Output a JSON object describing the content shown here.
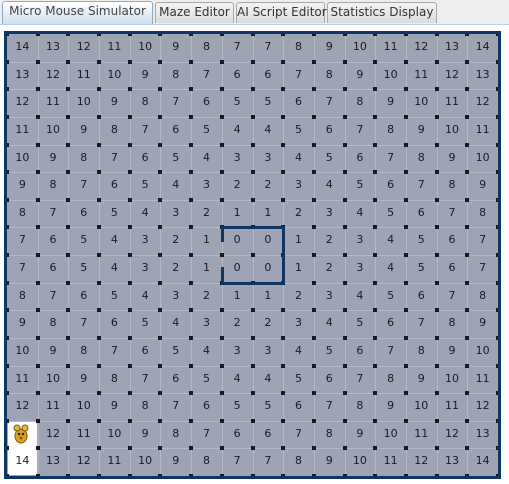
{
  "tabs": [
    {
      "label": "Micro Mouse Simulator",
      "active": true
    },
    {
      "label": "Maze Editor",
      "active": false
    },
    {
      "label": "AI Script Editor",
      "active": false
    },
    {
      "label": "Statistics Display",
      "active": false
    }
  ],
  "maze": {
    "rows": [
      [
        "14",
        "13",
        "12",
        "11",
        "10",
        "9",
        "8",
        "7",
        "7",
        "8",
        "9",
        "10",
        "11",
        "12",
        "13",
        "14"
      ],
      [
        "13",
        "12",
        "11",
        "10",
        "9",
        "8",
        "7",
        "6",
        "6",
        "7",
        "8",
        "9",
        "10",
        "11",
        "12",
        "13"
      ],
      [
        "12",
        "11",
        "10",
        "9",
        "8",
        "7",
        "6",
        "5",
        "5",
        "6",
        "7",
        "8",
        "9",
        "10",
        "11",
        "12"
      ],
      [
        "11",
        "10",
        "9",
        "8",
        "7",
        "6",
        "5",
        "4",
        "4",
        "5",
        "6",
        "7",
        "8",
        "9",
        "10",
        "11"
      ],
      [
        "10",
        "9",
        "8",
        "7",
        "6",
        "5",
        "4",
        "3",
        "3",
        "4",
        "5",
        "6",
        "7",
        "8",
        "9",
        "10"
      ],
      [
        "9",
        "8",
        "7",
        "6",
        "5",
        "4",
        "3",
        "2",
        "2",
        "3",
        "4",
        "5",
        "6",
        "7",
        "8",
        "9"
      ],
      [
        "8",
        "7",
        "6",
        "5",
        "4",
        "3",
        "2",
        "1",
        "1",
        "2",
        "3",
        "4",
        "5",
        "6",
        "7",
        "8"
      ],
      [
        "7",
        "6",
        "5",
        "4",
        "3",
        "2",
        "1",
        "0",
        "0",
        "1",
        "2",
        "3",
        "4",
        "5",
        "6",
        "7"
      ],
      [
        "7",
        "6",
        "5",
        "4",
        "3",
        "2",
        "1",
        "0",
        "0",
        "1",
        "2",
        "3",
        "4",
        "5",
        "6",
        "7"
      ],
      [
        "8",
        "7",
        "6",
        "5",
        "4",
        "3",
        "2",
        "1",
        "1",
        "2",
        "3",
        "4",
        "5",
        "6",
        "7",
        "8"
      ],
      [
        "9",
        "8",
        "7",
        "6",
        "5",
        "4",
        "3",
        "2",
        "2",
        "3",
        "4",
        "5",
        "6",
        "7",
        "8",
        "9"
      ],
      [
        "10",
        "9",
        "8",
        "7",
        "6",
        "5",
        "4",
        "3",
        "3",
        "4",
        "5",
        "6",
        "7",
        "8",
        "9",
        "10"
      ],
      [
        "11",
        "10",
        "9",
        "8",
        "7",
        "6",
        "5",
        "4",
        "4",
        "5",
        "6",
        "7",
        "8",
        "9",
        "10",
        "11"
      ],
      [
        "12",
        "11",
        "10",
        "9",
        "8",
        "7",
        "6",
        "5",
        "5",
        "6",
        "7",
        "8",
        "9",
        "10",
        "11",
        "12"
      ],
      [
        "",
        "12",
        "11",
        "10",
        "9",
        "8",
        "7",
        "6",
        "6",
        "7",
        "8",
        "9",
        "10",
        "11",
        "12",
        "13"
      ],
      [
        "14",
        "13",
        "12",
        "11",
        "10",
        "9",
        "8",
        "7",
        "7",
        "8",
        "9",
        "10",
        "11",
        "12",
        "13",
        "14"
      ]
    ],
    "mouse_icon": "mouse-icon",
    "colors": {
      "cell_fill": "#9ea4b4",
      "wall": "#0f3566",
      "post": "#1a1a1a",
      "start_cell": "#ffffff"
    }
  }
}
